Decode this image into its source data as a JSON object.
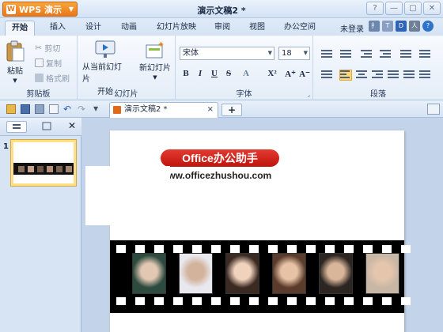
{
  "titlebar": {
    "app_menu_label": "WPS 演示",
    "app_menu_logo": "W",
    "document_title": "演示文稿2 *",
    "window_buttons": [
      "?",
      "—",
      "▢",
      "✕"
    ]
  },
  "tabs": {
    "items": [
      "开始",
      "插入",
      "设计",
      "动画",
      "幻灯片放映",
      "审阅",
      "视图",
      "办公空间"
    ],
    "active": "开始",
    "login_label": "未登录",
    "mini_icons": [
      "扌",
      "T",
      "D",
      "人",
      "?"
    ]
  },
  "ribbon": {
    "clipboard": {
      "paste_label": "粘贴",
      "cut_label": "剪切",
      "copy_label": "复制",
      "format_painter_label": "格式刷",
      "group_label": "剪贴板"
    },
    "slides": {
      "from_current_label_1": "从当前幻灯片",
      "from_current_label_2": "开始",
      "new_slide_label": "新幻灯片",
      "group_label": "幻灯片"
    },
    "font": {
      "font_name": "宋体",
      "font_size": "18",
      "format_buttons": [
        "B",
        "I",
        "U",
        "S",
        "A",
        "X²",
        "A⁺",
        "A⁻"
      ],
      "group_label": "字体"
    },
    "paragraph": {
      "group_label": "段落"
    }
  },
  "doc_tabs": {
    "active_tab_label": "演示文稿2 *",
    "close_label": "×",
    "new_tab_label": "+"
  },
  "slide_pane": {
    "slide_number": "1"
  },
  "slide": {
    "badge_text": "Office办公助手",
    "site_text": "www.officezhushou.com",
    "film_frames": 6
  },
  "colors": {
    "badge_red": "#d0201a",
    "accent_orange": "#e9781a",
    "ribbon_blue": "#d4e3f4"
  }
}
